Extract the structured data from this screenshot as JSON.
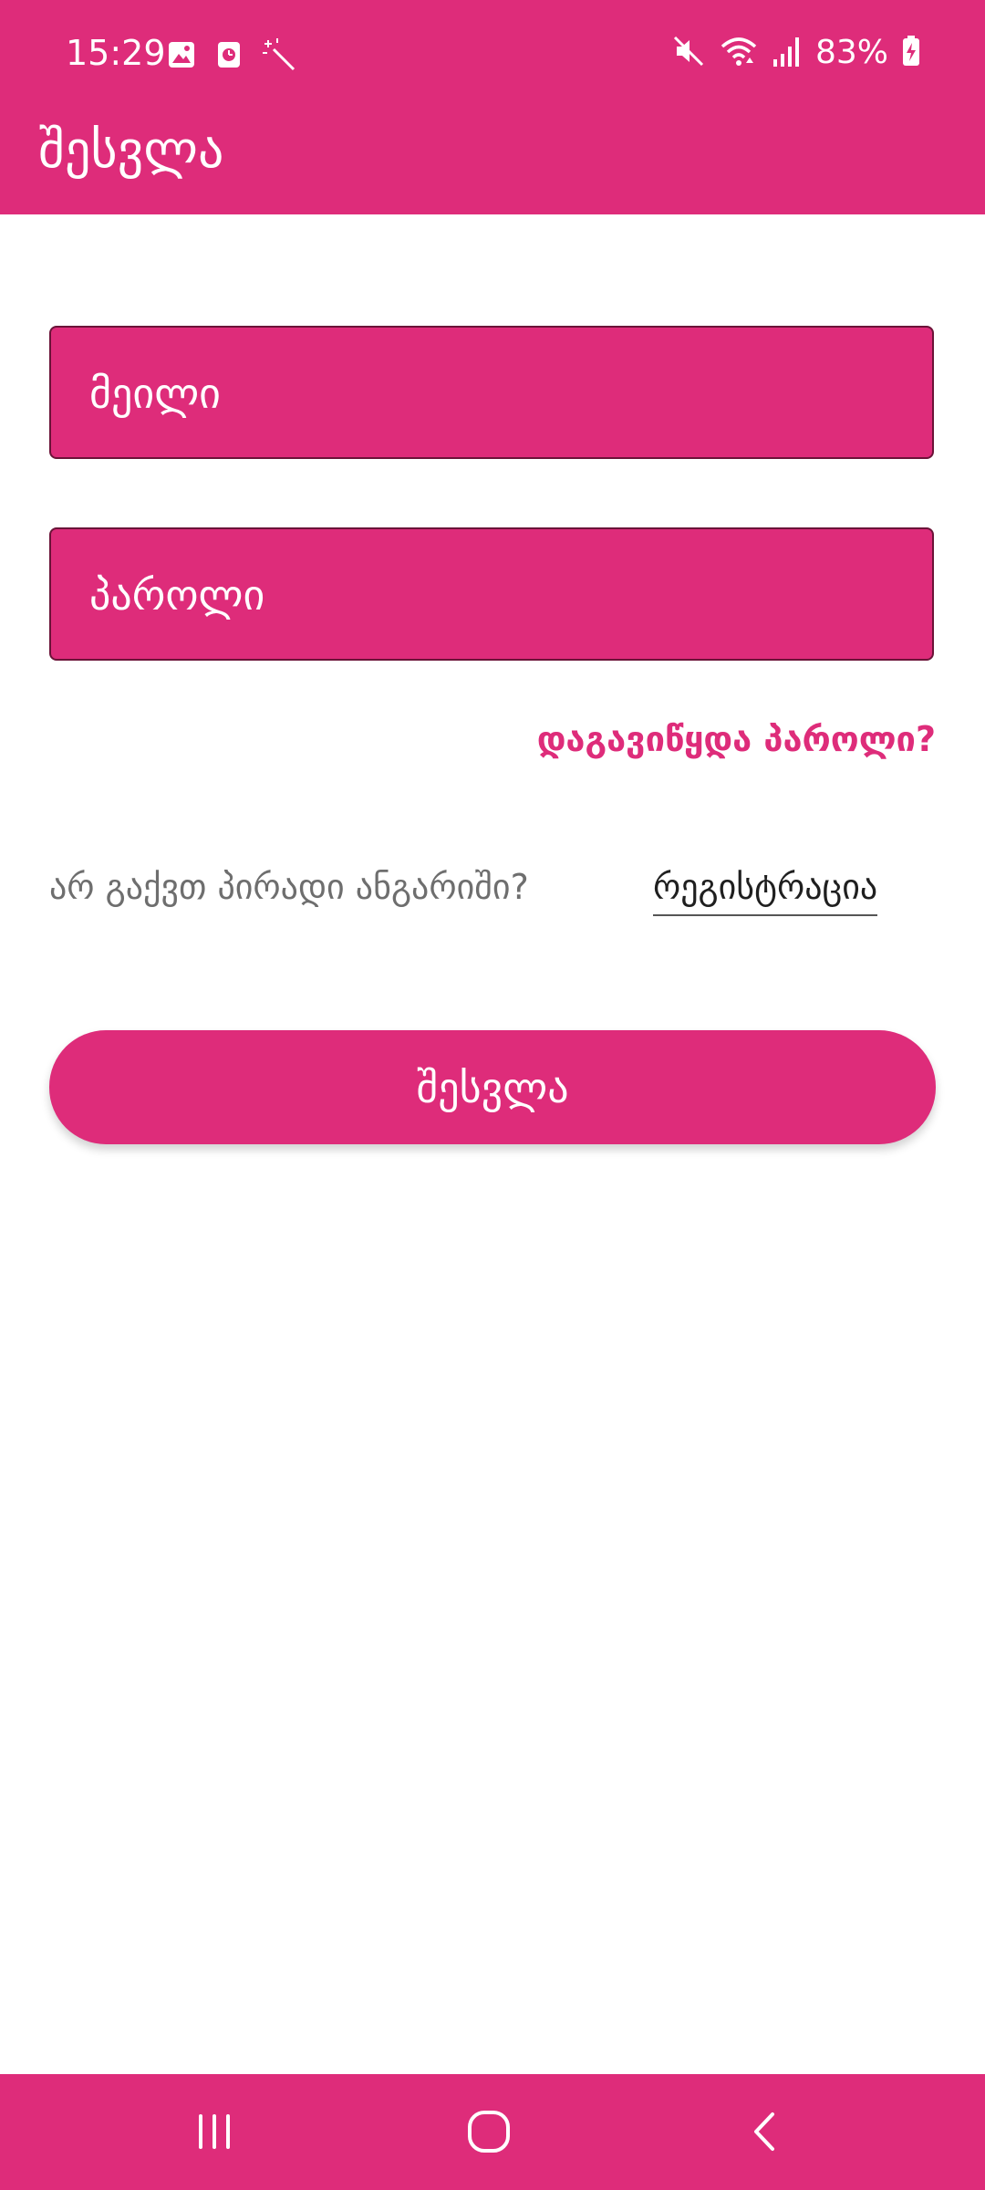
{
  "status_bar": {
    "time": "15:29",
    "battery": "83%",
    "icons_left": [
      "gallery-icon",
      "screen-record-icon",
      "magic-wand-icon"
    ],
    "icons_right": [
      "mute-icon",
      "wifi-icon",
      "signal-icon",
      "battery-charging-icon"
    ]
  },
  "app_bar": {
    "title": "შესვლა"
  },
  "form": {
    "email_placeholder": "მეილი",
    "password_placeholder": "პაროლი",
    "forgot_password": "დაგავიწყდა პაროლი?",
    "no_account": "არ გაქვთ პირადი ანგარიში?",
    "register": "რეგისტრაცია",
    "login_button": "შესვლა"
  },
  "nav_bar": {
    "buttons": [
      "recents-icon",
      "home-icon",
      "back-icon"
    ]
  },
  "colors": {
    "accent": "#de2c7a",
    "input_border": "#6b1338",
    "secondary_text": "#6e6e6e"
  }
}
